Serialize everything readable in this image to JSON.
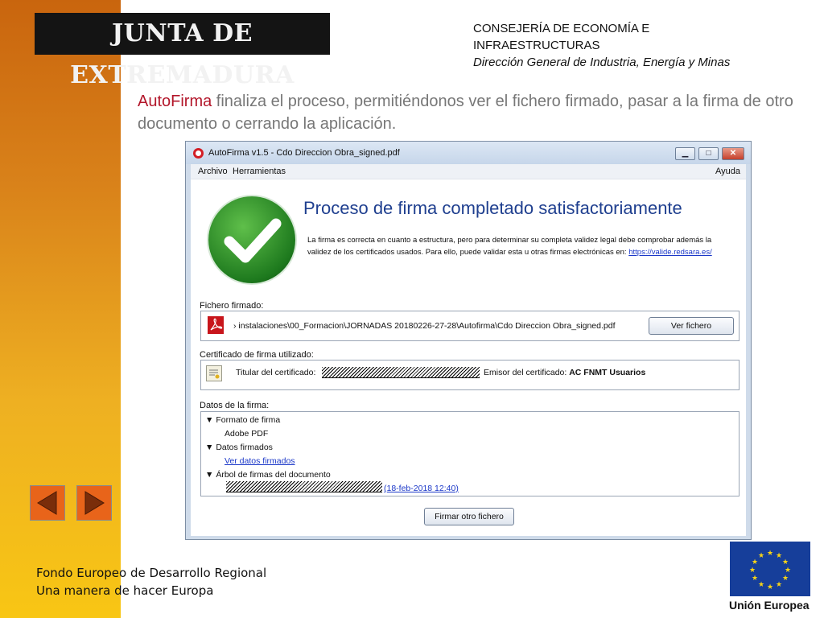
{
  "header": {
    "logo_text": "JUNTA DE EXTREMADURA",
    "consejeria_line1": "CONSEJERÍA DE ECONOMÍA E",
    "consejeria_line2": "INFRAESTRUCTURAS",
    "direccion": "Dirección General de Industria, Energía y Minas"
  },
  "intro": {
    "highlight": "AutoFirma",
    "text": " finaliza el proceso, permitiéndonos ver el fichero firmado, pasar a la firma de otro documento o cerrando la aplicación."
  },
  "window": {
    "title": "AutoFirma v1.5 - Cdo Direccion Obra_signed.pdf",
    "menu": {
      "archivo": "Archivo",
      "herramientas": "Herramientas",
      "ayuda": "Ayuda"
    },
    "headline": "Proceso de firma completado satisfactoriamente",
    "description": "La firma es correcta en cuanto a estructura, pero para determinar su completa validez legal debe comprobar además la validez de los certificados usados. Para ello, puede validar esta u otras firmas electrónicas en: ",
    "validation_link": "https://valide.redsara.es/",
    "signed_file": {
      "label": "Fichero firmado:",
      "path": "› instalaciones\\00_Formacion\\JORNADAS 20180226-27-28\\Autofirma\\Cdo Direccion Obra_signed.pdf",
      "view_button": "Ver fichero"
    },
    "certificate": {
      "label": "Certificado de firma utilizado:",
      "holder_label": "Titular del certificado:",
      "issuer_label": "Emisor del certificado:",
      "issuer_value": "AC FNMT Usuarios"
    },
    "signature_data": {
      "label": "Datos de la firma:",
      "format_heading": "Formato de firma",
      "format_value": "Adobe PDF",
      "signed_data_heading": "Datos firmados",
      "signed_data_link": "Ver datos firmados",
      "tree_heading": "Árbol de firmas del documento",
      "tree_date": "(18-feb-2018 12:40)"
    },
    "sign_other_button": "Firmar otro fichero"
  },
  "footer": {
    "line1": "Fondo Europeo de Desarrollo Regional",
    "line2": "Una manera de hacer Europa"
  },
  "eu_label": "Unión Europea",
  "colors": {
    "sidebar_top": "#c9650e",
    "sidebar_bottom": "#f8c614",
    "highlight": "#b3172b",
    "headline": "#1f3f8f",
    "nav_button": "#e8641a",
    "eu_blue": "#163e9a"
  }
}
